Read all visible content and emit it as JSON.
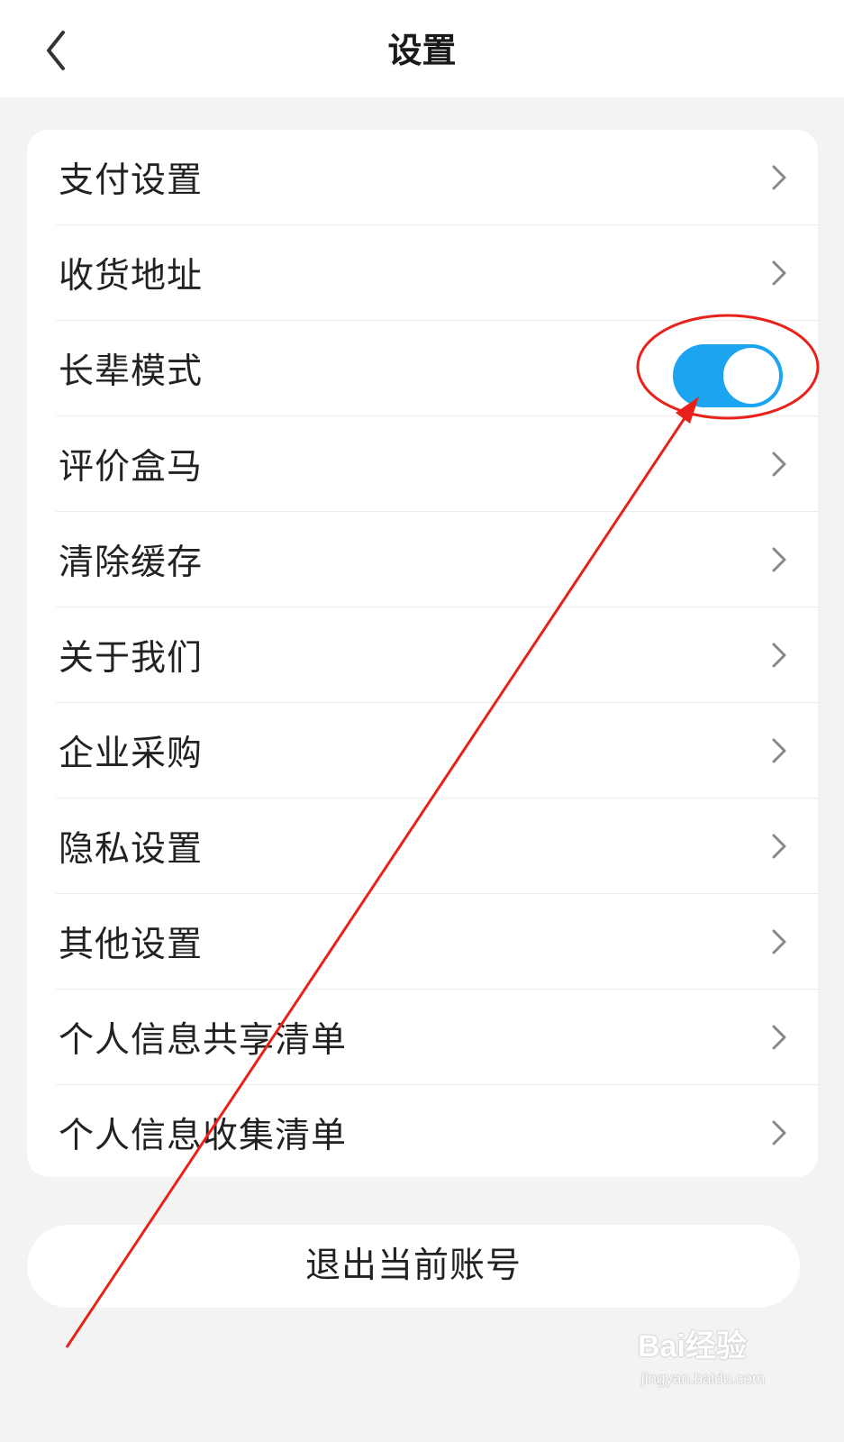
{
  "header": {
    "title": "设置",
    "back_icon": "chevron-left-icon"
  },
  "settings": {
    "items": [
      {
        "label": "支付设置",
        "control": "chevron"
      },
      {
        "label": "收货地址",
        "control": "chevron"
      },
      {
        "label": "长辈模式",
        "control": "toggle",
        "toggle_on": true
      },
      {
        "label": "评价盒马",
        "control": "chevron"
      },
      {
        "label": "清除缓存",
        "control": "chevron"
      },
      {
        "label": "关于我们",
        "control": "chevron"
      },
      {
        "label": "企业采购",
        "control": "chevron"
      },
      {
        "label": "隐私设置",
        "control": "chevron"
      },
      {
        "label": "其他设置",
        "control": "chevron"
      },
      {
        "label": "个人信息共享清单",
        "control": "chevron"
      },
      {
        "label": "个人信息收集清单",
        "control": "chevron"
      }
    ]
  },
  "logout": {
    "label": "退出当前账号"
  },
  "colors": {
    "toggle_on": "#1ba4f0",
    "annotation": "#e8221b",
    "background": "#f3f3f3"
  },
  "watermark": {
    "brand": "Bai经验",
    "url": "jingyan.baidu.com"
  }
}
